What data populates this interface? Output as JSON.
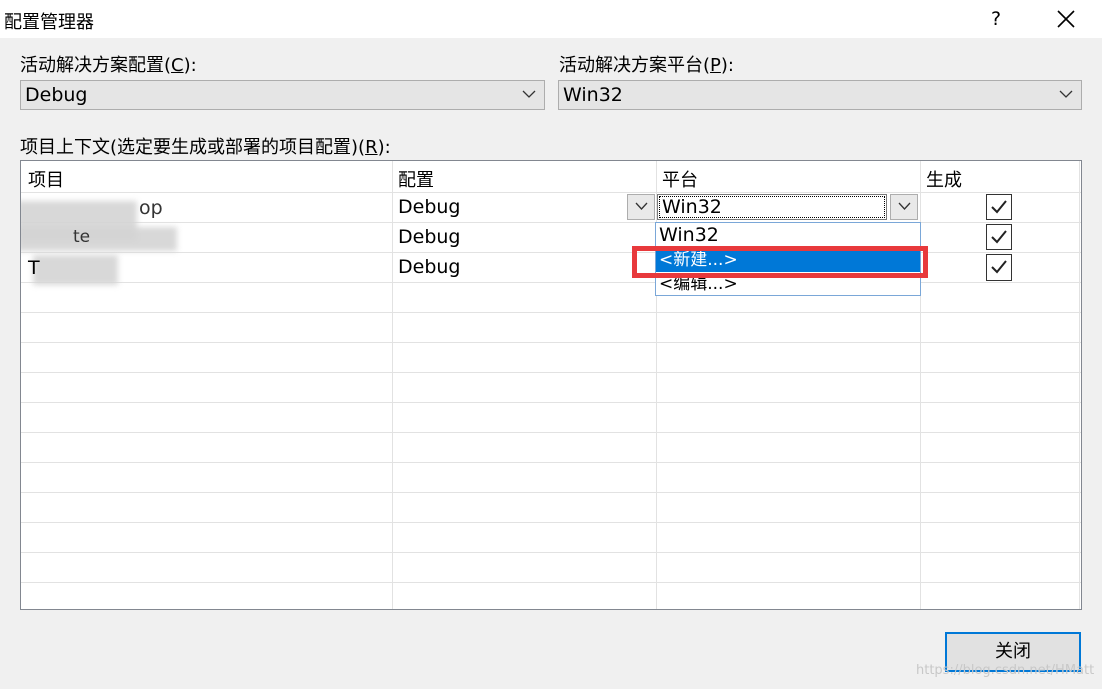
{
  "window": {
    "title": "配置管理器",
    "help_glyph": "?",
    "close_icon": "close-icon"
  },
  "active_config": {
    "label_text": "活动解决方案配置(",
    "label_mnemonic": "C",
    "label_tail": "):",
    "value": "Debug"
  },
  "active_platform": {
    "label_text": "活动解决方案平台(",
    "label_mnemonic": "P",
    "label_tail": "):",
    "value": "Win32"
  },
  "contexts": {
    "label_text": "项目上下文(选定要生成或部署的项目配置)(",
    "label_mnemonic": "R",
    "label_tail": "):",
    "columns": [
      "项目",
      "配置",
      "平台",
      "生成"
    ],
    "rows": [
      {
        "configuration": "Debug",
        "platform": "Win32",
        "build": true
      },
      {
        "configuration": "Debug",
        "build": true
      },
      {
        "configuration": "Debug",
        "build": true
      }
    ],
    "name_fragments": [
      "op",
      "te",
      "T"
    ]
  },
  "platform_dropdown": {
    "items": [
      "Win32",
      "<新建...>",
      "<编辑...>"
    ],
    "selected_index": 1
  },
  "footer": {
    "close_label": "关闭",
    "watermark": "https://blog.csdn.net/HMatt"
  },
  "colors": {
    "selection": "#0078d7",
    "highlight_box": "#e8393c"
  }
}
